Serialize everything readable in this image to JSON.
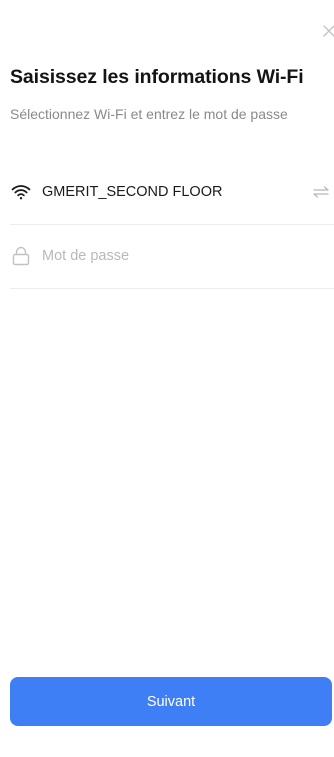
{
  "header": {
    "close_icon": "close-icon",
    "title": "Saisissez les informations Wi-Fi",
    "subtitle": "Sélectionnez Wi-Fi et entrez le mot de passe"
  },
  "wifi": {
    "icon": "wifi-icon",
    "ssid": "GMERIT_SECOND FLOOR",
    "switch_icon": "switch-network-icon"
  },
  "password": {
    "icon": "lock-icon",
    "value": "",
    "placeholder": "Mot de passe"
  },
  "footer": {
    "next_label": "Suivant"
  },
  "colors": {
    "accent": "#3f7ff6",
    "title_text": "#141414",
    "subtitle_text": "#8a8a8a",
    "placeholder_text": "#b9b9b9",
    "divider": "#ececec"
  }
}
